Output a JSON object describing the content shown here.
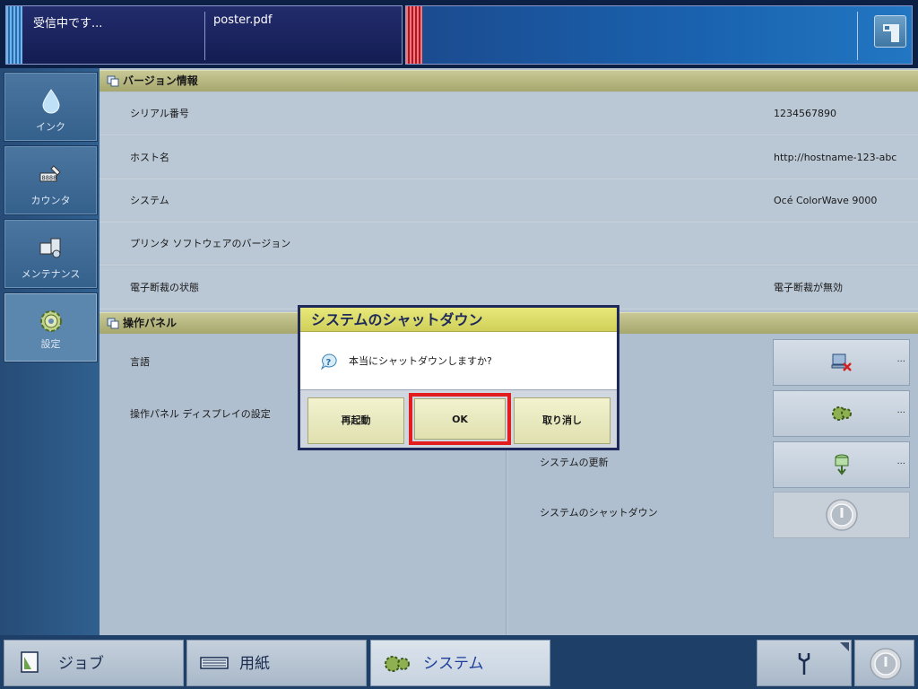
{
  "top": {
    "job_status": "受信中です...",
    "job_file": "poster.pdf"
  },
  "nav": {
    "items": [
      {
        "label": "インク"
      },
      {
        "label": "カウンタ"
      },
      {
        "label": "メンテナンス"
      },
      {
        "label": "設定"
      }
    ]
  },
  "version_section": {
    "title": "バージョン情報",
    "rows": [
      {
        "label": "シリアル番号",
        "value": "1234567890"
      },
      {
        "label": "ホスト名",
        "value": "http://hostname-123-abc"
      },
      {
        "label": "システム",
        "value": "Océ ColorWave 9000"
      },
      {
        "label": "プリンタ ソフトウェアのバージョン",
        "value": ""
      },
      {
        "label": "電子断裁の状態",
        "value": "電子断裁が無効"
      }
    ]
  },
  "panel_section": {
    "title": "操作パネル",
    "rows": [
      {
        "label": "言語"
      },
      {
        "label": "操作パネル ディスプレイの設定"
      }
    ]
  },
  "system_actions": {
    "rows": [
      {
        "label": "システムの更新"
      },
      {
        "label": "システムのシャットダウン"
      }
    ],
    "more": "..."
  },
  "dialog": {
    "title": "システムのシャットダウン",
    "message": "本当にシャットダウンしますか?",
    "restart_label": "再起動",
    "ok_label": "OK",
    "cancel_label": "取り消し"
  },
  "bottom_tabs": {
    "job": "ジョブ",
    "paper": "用紙",
    "system": "システム"
  },
  "colors": {
    "accent_highlight": "#e21d1d",
    "header_olive": "#b2b37b",
    "dialog_title_yellow": "#dada66",
    "nav_blue": "#30608f"
  }
}
